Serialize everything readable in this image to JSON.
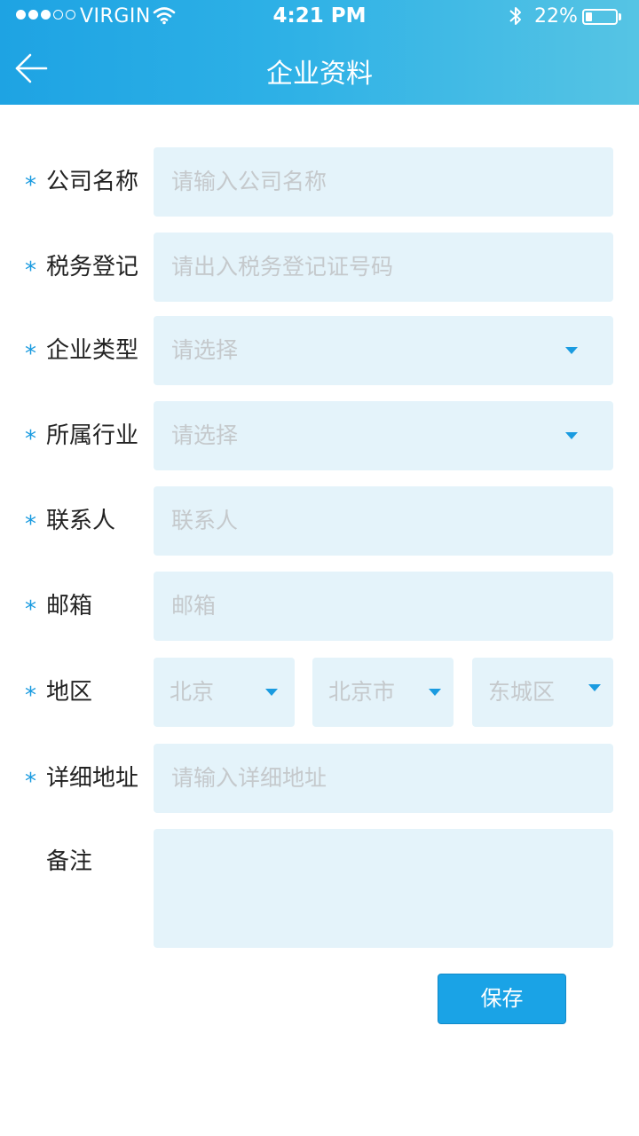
{
  "status_bar": {
    "carrier": "VIRGIN",
    "time": "4:21 PM",
    "battery": "22%",
    "battery_level": 0.22,
    "signal_bars_filled": 3,
    "signal_bars_total": 5,
    "icons": [
      "wifi-icon",
      "bluetooth-icon",
      "battery-icon"
    ]
  },
  "nav": {
    "title": "企业资料",
    "back_icon": "arrow-left-icon"
  },
  "colors": {
    "header_start": "#1ea3e3",
    "header_end": "#56c4e4",
    "accent": "#1a9be0",
    "field_bg": "#e4f3fa",
    "placeholder": "#c5c9cc"
  },
  "form": {
    "required_mark": "*",
    "company_name": {
      "label": "公司名称",
      "placeholder": "请输入公司名称",
      "required": true
    },
    "tax_registration": {
      "label": "税务登记",
      "placeholder": "请出入税务登记证号码",
      "required": true
    },
    "company_type": {
      "label": "企业类型",
      "value": "请选择",
      "required": true
    },
    "industry": {
      "label": "所属行业",
      "value": "请选择",
      "required": true
    },
    "contact": {
      "label": "联系人",
      "placeholder": "联系人",
      "required": true
    },
    "email": {
      "label": "邮箱",
      "placeholder": "邮箱",
      "required": true
    },
    "region": {
      "label": "地区",
      "required": true,
      "province": "北京",
      "city": "北京市",
      "district": "东城区"
    },
    "address": {
      "label": "详细地址",
      "placeholder": "请输入详细地址",
      "required": true
    },
    "remarks": {
      "label": "备注",
      "placeholder": "",
      "required": false
    }
  },
  "actions": {
    "save_label": "保存"
  }
}
